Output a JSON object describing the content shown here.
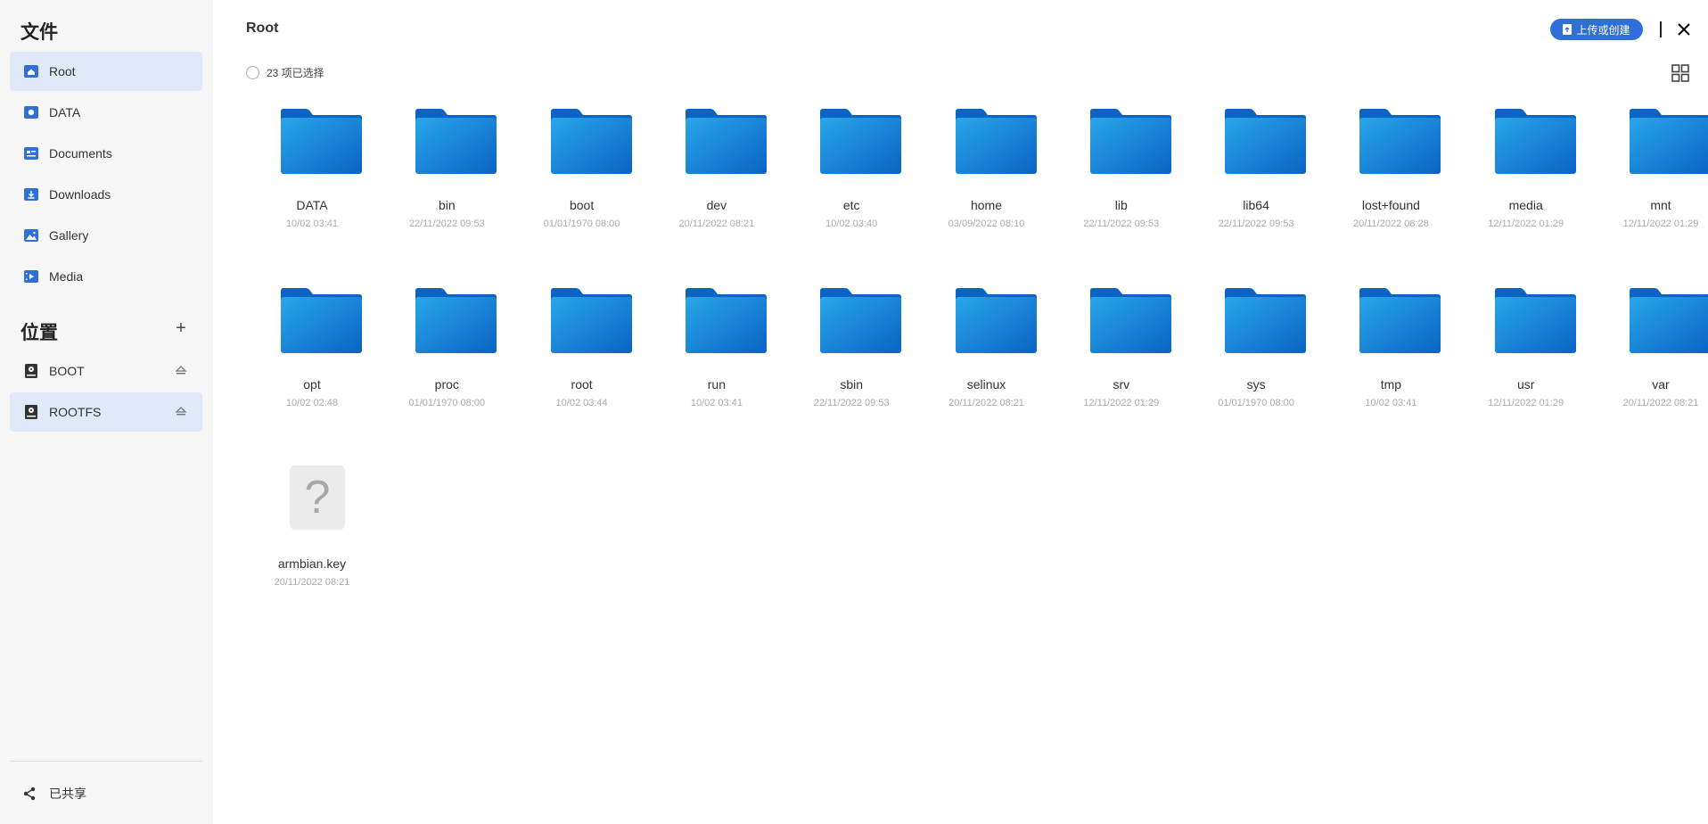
{
  "sidebar": {
    "files_title": "文件",
    "locations_title": "位置",
    "add_symbol": "+",
    "shared_label": "已共享",
    "items": [
      {
        "label": "Root",
        "icon": "home-icon"
      },
      {
        "label": "DATA",
        "icon": "data-icon"
      },
      {
        "label": "Documents",
        "icon": "documents-icon"
      },
      {
        "label": "Downloads",
        "icon": "downloads-icon"
      },
      {
        "label": "Gallery",
        "icon": "gallery-icon"
      },
      {
        "label": "Media",
        "icon": "media-icon"
      }
    ],
    "locations": [
      {
        "label": "BOOT",
        "icon": "drive-icon"
      },
      {
        "label": "ROOTFS",
        "icon": "drive-icon"
      }
    ]
  },
  "header": {
    "title": "Root",
    "upload_label": "上传或创建",
    "selection_text": "23 项已选择"
  },
  "colors": {
    "accent": "#2f6fd6",
    "folder_light": "#29a6ea",
    "folder_dark": "#0b63c4",
    "selected_bg": "#dfe9f8"
  },
  "files": [
    {
      "name": "DATA",
      "date": "10/02 03:41",
      "type": "folder"
    },
    {
      "name": "bin",
      "date": "22/11/2022 09:53",
      "type": "folder"
    },
    {
      "name": "boot",
      "date": "01/01/1970 08:00",
      "type": "folder"
    },
    {
      "name": "dev",
      "date": "20/11/2022 08:21",
      "type": "folder"
    },
    {
      "name": "etc",
      "date": "10/02 03:40",
      "type": "folder"
    },
    {
      "name": "home",
      "date": "03/09/2022 08:10",
      "type": "folder"
    },
    {
      "name": "lib",
      "date": "22/11/2022 09:53",
      "type": "folder"
    },
    {
      "name": "lib64",
      "date": "22/11/2022 09:53",
      "type": "folder"
    },
    {
      "name": "lost+found",
      "date": "20/11/2022 08:28",
      "type": "folder"
    },
    {
      "name": "media",
      "date": "12/11/2022 01:29",
      "type": "folder"
    },
    {
      "name": "mnt",
      "date": "12/11/2022 01:29",
      "type": "folder"
    },
    {
      "name": "opt",
      "date": "10/02 02:48",
      "type": "folder"
    },
    {
      "name": "proc",
      "date": "01/01/1970 08:00",
      "type": "folder"
    },
    {
      "name": "root",
      "date": "10/02 03:44",
      "type": "folder"
    },
    {
      "name": "run",
      "date": "10/02 03:41",
      "type": "folder"
    },
    {
      "name": "sbin",
      "date": "22/11/2022 09:53",
      "type": "folder"
    },
    {
      "name": "selinux",
      "date": "20/11/2022 08:21",
      "type": "folder"
    },
    {
      "name": "srv",
      "date": "12/11/2022 01:29",
      "type": "folder"
    },
    {
      "name": "sys",
      "date": "01/01/1970 08:00",
      "type": "folder"
    },
    {
      "name": "tmp",
      "date": "10/02 03:41",
      "type": "folder"
    },
    {
      "name": "usr",
      "date": "12/11/2022 01:29",
      "type": "folder"
    },
    {
      "name": "var",
      "date": "20/11/2022 08:21",
      "type": "folder"
    },
    {
      "name": "armbian.key",
      "date": "20/11/2022 08:21",
      "type": "unknown",
      "glyph": "?"
    }
  ]
}
